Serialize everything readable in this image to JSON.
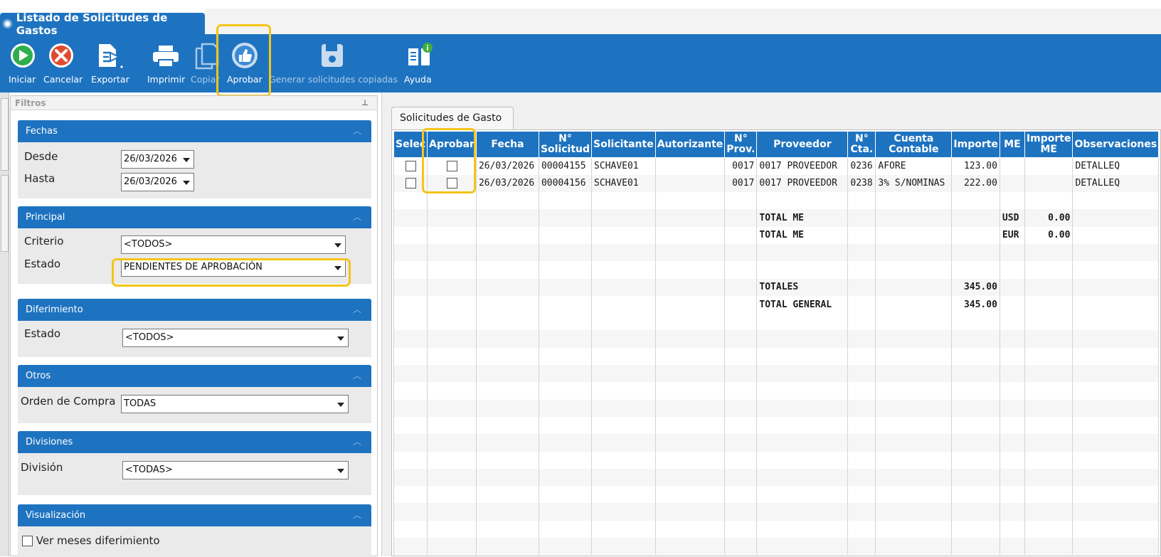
{
  "window": {
    "title": "Listado de Solicitudes de Gastos"
  },
  "toolbar": {
    "buttons": [
      {
        "id": "iniciar",
        "label": "Iniciar",
        "icon": "play-circle-icon"
      },
      {
        "id": "cancelar",
        "label": "Cancelar",
        "icon": "cancel-circle-icon"
      },
      {
        "id": "exportar",
        "label": "Exportar",
        "icon": "export-icon"
      },
      {
        "id": "imprimir",
        "label": "Imprimir",
        "icon": "printer-icon"
      },
      {
        "id": "copiar",
        "label": "Copiar",
        "icon": "copy-icon"
      },
      {
        "id": "aprobar",
        "label": "Aprobar",
        "icon": "thumbs-up-icon"
      },
      {
        "id": "generar",
        "label": "Generar solicitudes copiadas",
        "icon": "save-disk-icon"
      },
      {
        "id": "ayuda",
        "label": "Ayuda",
        "icon": "help-book-icon"
      }
    ]
  },
  "filters": {
    "title": "Filtros",
    "fechas": {
      "title": "Fechas",
      "desde_label": "Desde",
      "desde_value": "26/03/2026",
      "hasta_label": "Hasta",
      "hasta_value": "26/03/2026"
    },
    "principal": {
      "title": "Principal",
      "criterio_label": "Criterio",
      "criterio_value": "<TODOS>",
      "estado_label": "Estado",
      "estado_value": "PENDIENTES DE APROBACIÓN"
    },
    "diferimiento": {
      "title": "Diferimiento",
      "estado_label": "Estado",
      "estado_value": "<TODOS>"
    },
    "otros": {
      "title": "Otros",
      "orden_label": "Orden de Compra",
      "orden_value": "TODAS"
    },
    "divisiones": {
      "title": "Divisiones",
      "division_label": "División",
      "division_value": "<TODAS>"
    },
    "visualizacion": {
      "title": "Visualización",
      "ver_meses_label": "Ver meses diferimiento"
    }
  },
  "grid": {
    "tab_label": "Solicitudes de Gasto",
    "columns": [
      "Selec",
      "Aprobar",
      "Fecha",
      "N° Solicitud",
      "Solicitante",
      "Autorizante",
      "N° Prov.",
      "Proveedor",
      "N° Cta.",
      "Cuenta Contable",
      "Importe",
      "ME",
      "Importe ME",
      "Observaciones"
    ],
    "rows": [
      {
        "fecha": "26/03/2026",
        "solicitud": "00004155",
        "solicitante": "SCHAVE01",
        "autorizante": "",
        "prov": "0017",
        "proveedor": "0017 PROVEEDOR",
        "cta": "0236",
        "cuenta": "AFORE",
        "importe": "123.00",
        "me": "",
        "importe_me": "",
        "obs": "DETALLEQ"
      },
      {
        "fecha": "26/03/2026",
        "solicitud": "00004156",
        "solicitante": "SCHAVE01",
        "autorizante": "",
        "prov": "0017",
        "proveedor": "0017 PROVEEDOR",
        "cta": "0238",
        "cuenta": "3% S/NOMINAS",
        "importe": "222.00",
        "me": "",
        "importe_me": "",
        "obs": "DETALLEQ"
      }
    ],
    "totals": {
      "total_me_label": "TOTAL ME",
      "usd": {
        "currency": "USD",
        "value": "0.00"
      },
      "eur": {
        "currency": "EUR",
        "value": "0.00"
      },
      "totales_label": "TOTALES",
      "totales_value": "345.00",
      "general_label": "TOTAL GENERAL",
      "general_value": "345.00"
    }
  }
}
